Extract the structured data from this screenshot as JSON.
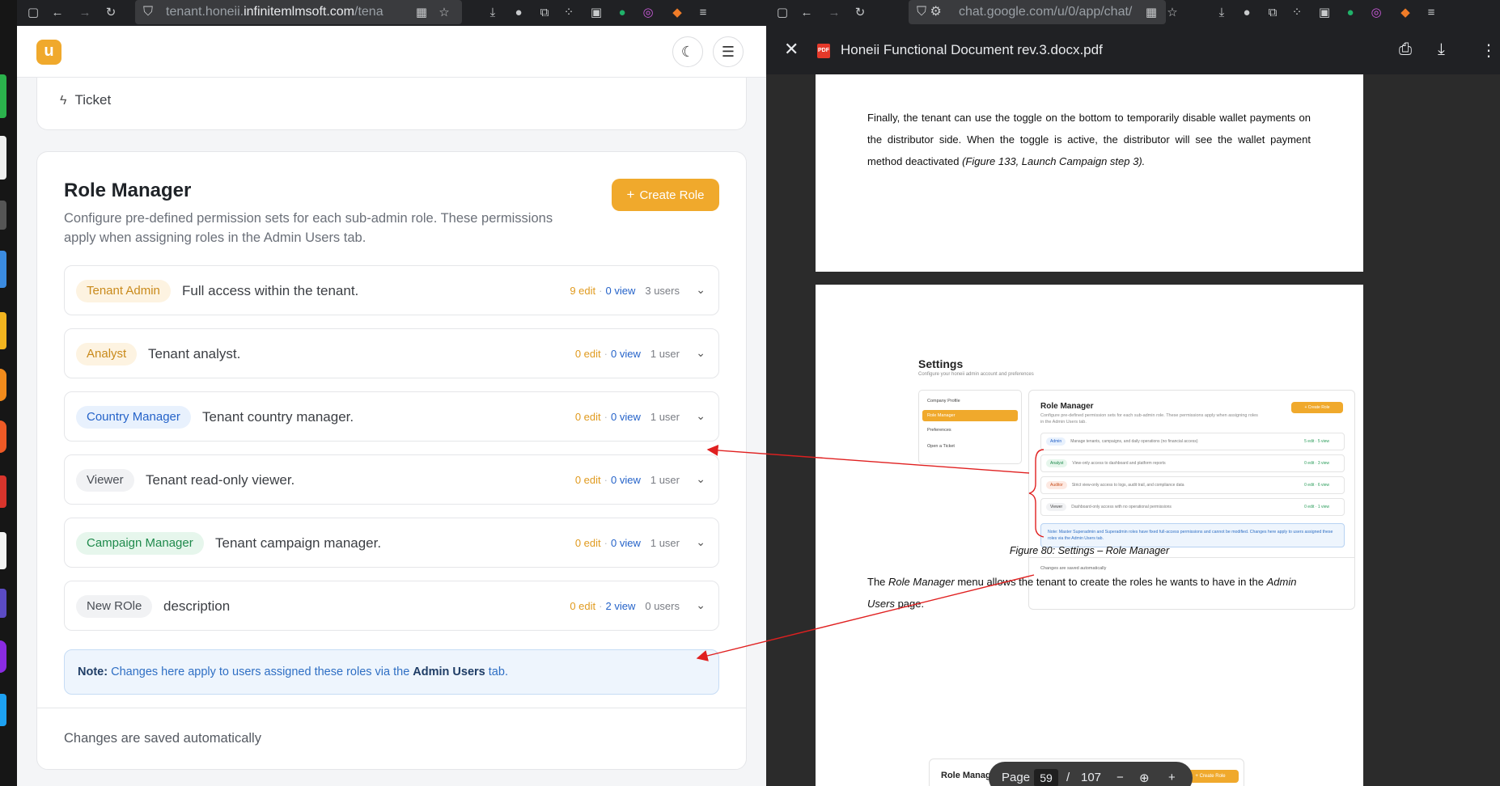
{
  "left_browser": {
    "url_host": "tenant.honeii.",
    "url_domain": "infinitemlmsoft.com",
    "url_path": "/tena"
  },
  "app": {
    "logo_letter": "u",
    "theme_toggle_icon": "moon-icon",
    "menu_icon": "hamburger-icon",
    "ticket_label": "Ticket"
  },
  "role_manager": {
    "title": "Role Manager",
    "description": "Configure pre-defined permission sets for each sub-admin role. These permissions apply when assigning roles in the Admin Users tab.",
    "create_button": "Create Role",
    "roles": [
      {
        "name": "Tenant Admin",
        "description": "Full access within the tenant.",
        "edit": "9 edit",
        "view": "0 view",
        "users": "3 users",
        "badge_bg": "#fdf3e1",
        "badge_fg": "#c98a1b"
      },
      {
        "name": "Analyst",
        "description": "Tenant analyst.",
        "edit": "0 edit",
        "view": "0 view",
        "users": "1 user",
        "badge_bg": "#fdf3e1",
        "badge_fg": "#c98a1b"
      },
      {
        "name": "Country Manager",
        "description": "Tenant country manager.",
        "edit": "0 edit",
        "view": "0 view",
        "users": "1 user",
        "badge_bg": "#e8f1fd",
        "badge_fg": "#2563c9"
      },
      {
        "name": "Viewer",
        "description": "Tenant read-only viewer.",
        "edit": "0 edit",
        "view": "0 view",
        "users": "1 user",
        "badge_bg": "#f1f2f4",
        "badge_fg": "#4a4e55"
      },
      {
        "name": "Campaign Manager",
        "description": "Tenant campaign manager.",
        "edit": "0 edit",
        "view": "0 view",
        "users": "1 user",
        "badge_bg": "#e6f6ec",
        "badge_fg": "#1f8a4c"
      },
      {
        "name": "New ROle",
        "description": "description",
        "edit": "0 edit",
        "view": "2 view",
        "users": "0 users",
        "badge_bg": "#f1f2f4",
        "badge_fg": "#4a4e55"
      }
    ],
    "note_label": "Note:",
    "note_text": "Changes here apply to users assigned these roles via the",
    "note_link": "Admin Users",
    "note_suffix": "tab.",
    "footer": "Changes are saved automatically"
  },
  "right_browser": {
    "url_text": "chat.google.com/u/0/app/chat/"
  },
  "pdf": {
    "title": "Honeii Functional Document rev.3.docx.pdf",
    "paragraph1": "Finally, the tenant can use the toggle on the bottom to temporarily disable wallet payments on the distributor side. When the toggle is active, the distributor will see the wallet payment method deactivated",
    "paragraph1_ref": "(Figure 133, Launch Campaign step 3).",
    "figure": {
      "settings_title": "Settings",
      "settings_subtitle": "Configure your honeii admin account and preferences",
      "sidebar": [
        "Company Profile",
        "Role Manager",
        "Preferences",
        "Open a Ticket"
      ],
      "title": "Role Manager",
      "description": "Configure pre-defined permission sets for each sub-admin role. These permissions apply when assigning roles in the Admin Users tab.",
      "create_button": "+ Create Role",
      "rows": [
        {
          "badge": "Admin",
          "text": "Manage tenants, campaigns, and daily operations (no financial access)",
          "meta": "5 edit · 5 view"
        },
        {
          "badge": "Analyst",
          "text": "View-only access to dashboard and platform reports",
          "meta": "0 edit · 3 view"
        },
        {
          "badge": "Auditor",
          "text": "Strict view-only access to logs, audit trail, and compliance data",
          "meta": "0 edit · 6 view"
        },
        {
          "badge": "Viewer",
          "text": "Dashboard-only access with no operational permissions",
          "meta": "0 edit · 1 view"
        }
      ],
      "note": "Note: Master Superadmin and Superadmin roles have fixed full-access permissions and cannot be modified. Changes here apply to users assigned these roles via the Admin Users tab.",
      "footer": "Changes are saved automatically"
    },
    "caption": "Figure 80: Settings – Role Manager",
    "paragraph2_pre": "The",
    "paragraph2_em1": "Role Manager",
    "paragraph2_mid": "menu allows the tenant to create the roles he wants to have in the",
    "paragraph2_em2": "Admin Users",
    "paragraph2_post": "page.",
    "next_preview_title": "Role Manager",
    "next_preview_button": "+ Create Role",
    "page_label": "Page",
    "page_current": "59",
    "page_total": "107"
  },
  "annotation_color": "#e02020"
}
